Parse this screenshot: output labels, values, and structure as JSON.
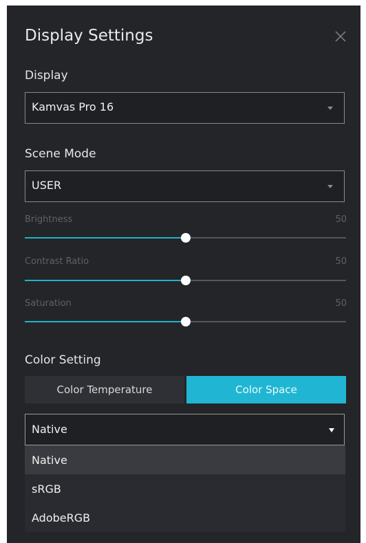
{
  "dialog": {
    "title": "Display Settings",
    "close_icon": "close-icon"
  },
  "display": {
    "label": "Display",
    "value": "Kamvas Pro 16"
  },
  "scene_mode": {
    "label": "Scene Mode",
    "value": "USER"
  },
  "sliders": [
    {
      "label": "Brightness",
      "value": "50",
      "level": 0.5
    },
    {
      "label": "Contrast Ratio",
      "value": "50",
      "level": 0.5
    },
    {
      "label": "Saturation",
      "value": "50",
      "level": 0.5
    }
  ],
  "color_setting": {
    "label": "Color Setting",
    "tabs": [
      {
        "label": "Color Temperature",
        "active": false
      },
      {
        "label": "Color Space",
        "active": true
      }
    ],
    "select_value": "Native",
    "options": [
      "Native",
      "sRGB",
      "AdobeRGB"
    ],
    "selected_option": "Native"
  },
  "colors": {
    "accent": "#20b6d3",
    "panel_bg": "#242529"
  }
}
